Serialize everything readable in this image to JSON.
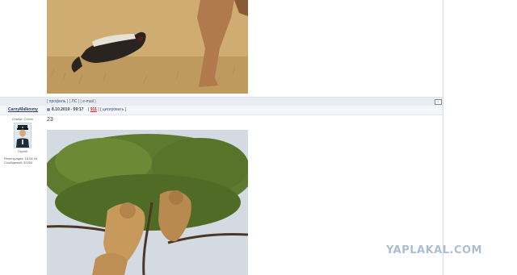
{
  "post_1": {
    "image_alt": "honey badger facing a large animal's leg on dry savanna ground",
    "actions": {
      "profile": "профиль",
      "pm": "ЛС",
      "email": "e-mail"
    },
    "top_button": "^"
  },
  "post_2": {
    "author": "CarnyMalkovny",
    "date": "8.10.2019 - 09:17",
    "rating": "911",
    "quote": "цитировать",
    "status_label": "Статус:",
    "status_value": "Online",
    "group": "Пулей",
    "registered": "Регистрация: 18.06.16",
    "messages": "Сообщений: 32263",
    "text": "23",
    "image_alt": "lions resting in an acacia tree"
  },
  "watermark": "YAPLAKAL.COM",
  "colors": {
    "rating": "#cc2222",
    "online": "#3a9b3a",
    "watermark": "#9fb3c8",
    "bar": "#e9edf2"
  }
}
